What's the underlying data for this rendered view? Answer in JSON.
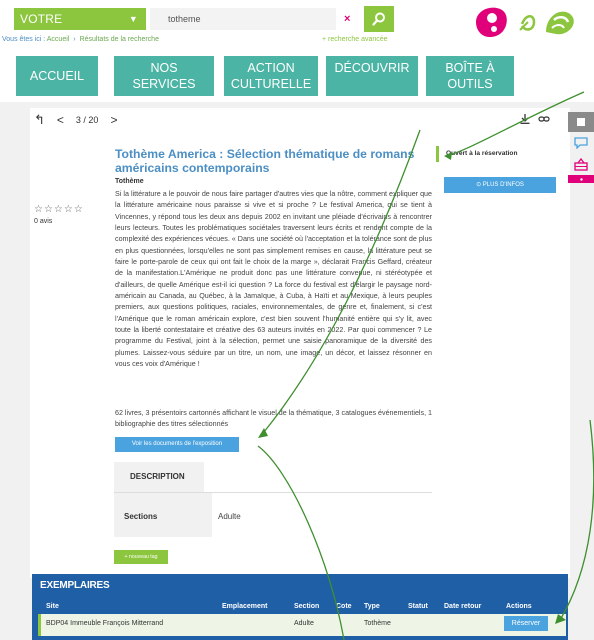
{
  "header": {
    "search_scope": "VOTRE RECHERCHE...",
    "search_value": "totheme",
    "clear_symbol": "×",
    "breadcrumb_prefix": "Vous êtes ici :",
    "breadcrumb_items": [
      "Accueil",
      "Résultats de la recherche"
    ],
    "advanced_link": "+ recherche avancée",
    "colors": {
      "green": "#8cc63f",
      "teal": "#4cb4a4",
      "pink": "#e0007a",
      "blue": "#4aa3df",
      "navy": "#1f5fa6"
    }
  },
  "nav": [
    {
      "label": "ACCUEIL"
    },
    {
      "label": "NOS SERVICES"
    },
    {
      "label": "ACTION CULTURELLE"
    },
    {
      "label": "DÉCOUVRIR"
    },
    {
      "label": "BOÎTE À OUTILS"
    }
  ],
  "pager": {
    "back_symbol": "↰",
    "prev_symbol": "<",
    "count": "3 / 20",
    "next_symbol": ">"
  },
  "record": {
    "stars": "☆☆☆☆☆",
    "reviews": "0 avis",
    "title": "Tothème America : Sélection thématique de romans américains contemporains",
    "author": "Tothème",
    "description": "Si la littérature a le pouvoir de nous faire partager d'autres vies que la nôtre, comment expliquer que la littérature américaine nous paraisse si vive et si proche ? Le festival America, qui se tient à Vincennes, y répond tous les deux ans depuis 2002 en invitant une pléiade d'écrivains à rencontrer leurs lecteurs. Toutes les problématiques sociétales traversent leurs écrits et rendent compte de la complexité des expériences vécues. « Dans une société où l'acceptation et la tolérance sont de plus en plus questionnées, lorsqu'elles ne sont pas simplement remises en cause, la littérature peut se faire le porte-parole de ceux qui ont fait le choix de la marge », déclarait Francis Geffard, créateur de la manifestation.L'Amérique ne produit donc pas une littérature convenue, ni stéréotypée et d'ailleurs, de quelle Amérique est-il ici question ? La force du festival est d'élargir le paysage nord-américain au Canada, au Québec, à la Jamaïque, à Cuba, à Haïti et au Mexique, à leurs peuples premiers, aux questions politiques, raciales, environnementales, de genre et, finalement, si c'est l'Amérique que le roman américain explore, c'est bien souvent l'humanité entière qui s'y lit, avec toute la liberté contestataire et créative des 63 auteurs invités en 2022. Par quoi commencer ? Le programme du Festival, joint à la sélection, permet une saisie panoramique de la diversité des plumes. Laissez-vous séduire par un titre, un nom, une image, un décor, et laissez résonner en vous ces voix d'Amérique !",
    "contents": "62 livres, 3 présentoirs cartonnés affichant le visuel de la thématique, 3 catalogues événementiels, 1 bibliographie des titres sélectionnés",
    "docs_button": "Voir les documents de l'exposition",
    "availability": "Ouvert à la réservation",
    "more_info_button": "⊙ PLUS D'INFOS",
    "tab_label": "DESCRIPTION",
    "sections_label": "Sections",
    "sections_value": "Adulte",
    "new_tag_button": "+ nouveau tag"
  },
  "exemplaires": {
    "title": "EXEMPLAIRES",
    "columns": [
      "Site",
      "Emplacement",
      "Section",
      "Cote",
      "Type",
      "Statut",
      "Date retour",
      "Actions"
    ],
    "rows": [
      {
        "site": "BDP04 Immeuble François Mitterrand",
        "emplacement": "",
        "section": "Adulte",
        "cote": "",
        "type": "Tothème",
        "statut": "",
        "date_retour": "",
        "action": "Réserver"
      }
    ]
  }
}
